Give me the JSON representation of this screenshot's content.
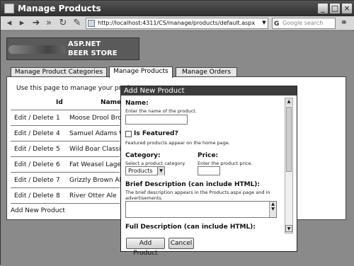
{
  "window": {
    "title": "Manage Products"
  },
  "toolbar": {
    "address": "http://localhost:4311/CS/manage/products/default.aspx",
    "search_placeholder": "Google search"
  },
  "logo": {
    "line1": "ASP.NET",
    "line2": "BEER STORE"
  },
  "tabs": [
    {
      "label": "Manage Product Categories"
    },
    {
      "label": "Manage Products"
    },
    {
      "label": "Manage Orders"
    }
  ],
  "main": {
    "intro": "Use this page to manage your produ",
    "columns": [
      "Id",
      "Name"
    ],
    "rows": [
      {
        "action": "Edit / Delete",
        "id": "1",
        "name": "Moose Drool Brow"
      },
      {
        "action": "Edit / Delete",
        "id": "4",
        "name": "Samuel Adams Wi"
      },
      {
        "action": "Edit / Delete",
        "id": "5",
        "name": "Wild Boar Classic"
      },
      {
        "action": "Edit / Delete",
        "id": "6",
        "name": "Fat Weasel Lager"
      },
      {
        "action": "Edit / Delete",
        "id": "7",
        "name": "Grizzly Brown Ale"
      },
      {
        "action": "Edit / Delete",
        "id": "8",
        "name": "River Otter Ale"
      }
    ],
    "add_link": "Add New Product"
  },
  "modal": {
    "title": "Add New Product",
    "name_label": "Name:",
    "name_help": "Enter the name of the product.",
    "featured_label": "Is Featured?",
    "featured_help": "Featured products appear on the home page.",
    "category_label": "Category:",
    "category_help": "Select a product category.",
    "category_value": "Products",
    "price_label": "Price:",
    "price_help": "Enter the product price.",
    "brief_label": "Brief Description (can include HTML):",
    "brief_help1": "The brief description appears in the Products.aspx page and in",
    "brief_help2": "advertisements.",
    "full_label": "Full Description (can include HTML):",
    "add_button": "Add Product",
    "cancel_button": "Cancel"
  }
}
